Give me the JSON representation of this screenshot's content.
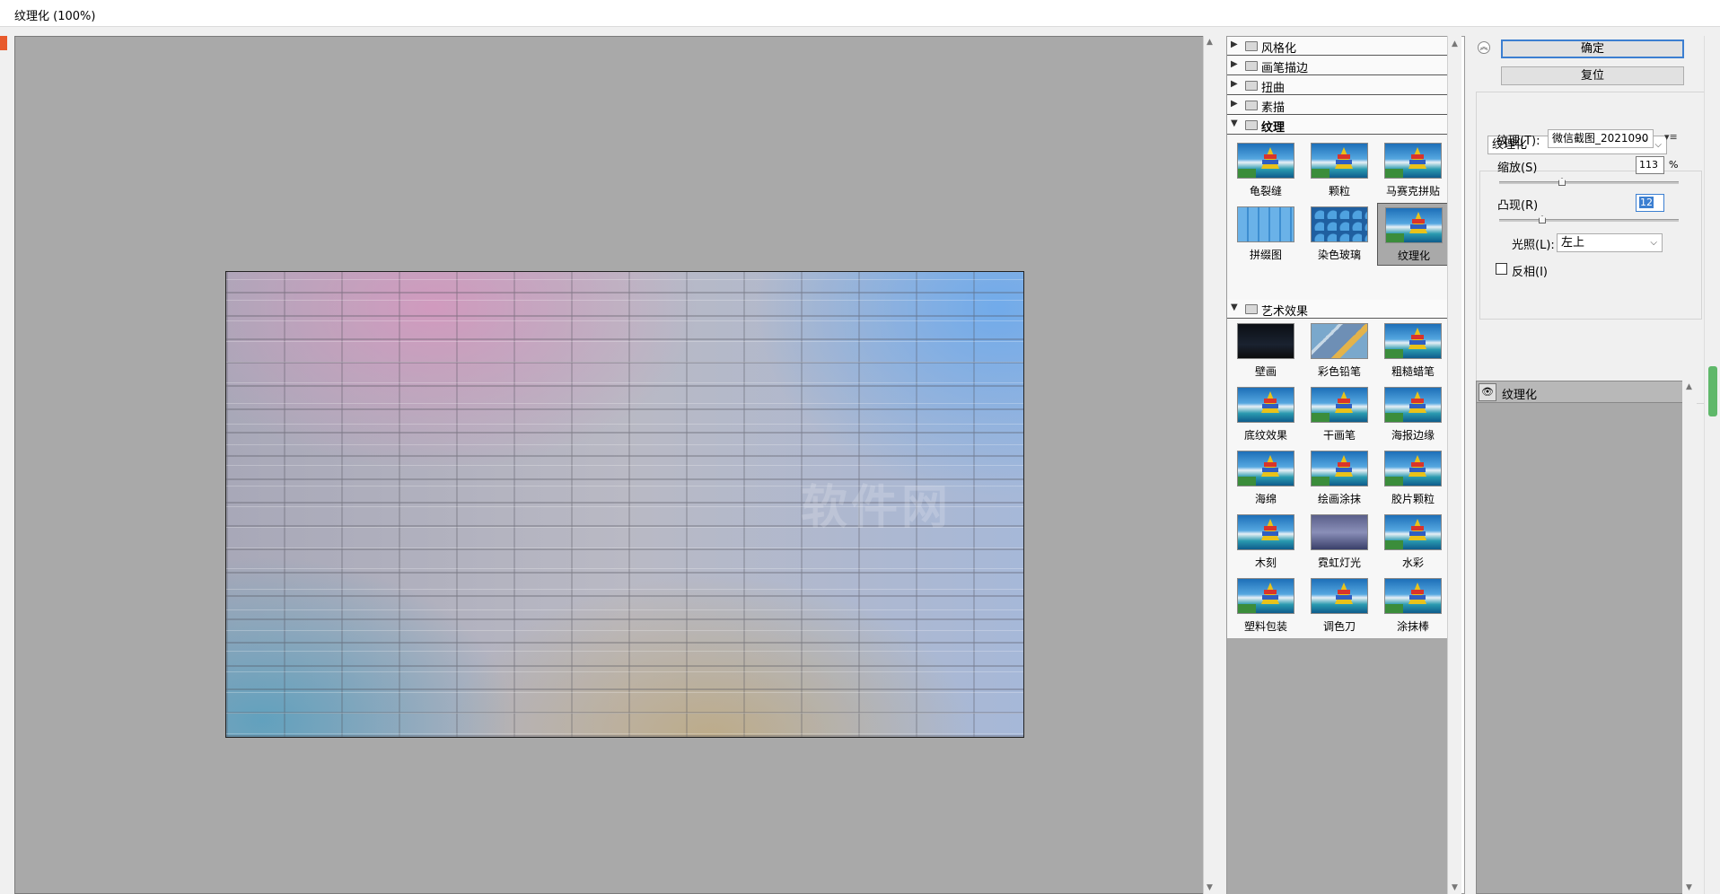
{
  "window": {
    "title": "纹理化 (100%)"
  },
  "preview": {
    "watermark": "软件网"
  },
  "filter_gallery": {
    "categories_collapsed": [
      "风格化",
      "画笔描边",
      "扭曲",
      "素描"
    ],
    "texture_category": "纹理",
    "texture_filters": [
      "龟裂缝",
      "颗粒",
      "马赛克拼贴",
      "拼缀图",
      "染色玻璃",
      "纹理化"
    ],
    "selected_filter": "纹理化",
    "art_category": "艺术效果",
    "art_filters": [
      "壁画",
      "彩色铅笔",
      "粗糙蜡笔",
      "底纹效果",
      "干画笔",
      "海报边缘",
      "海绵",
      "绘画涂抹",
      "胶片颗粒",
      "木刻",
      "霓虹灯光",
      "水彩",
      "塑料包装",
      "调色刀",
      "涂抹棒"
    ]
  },
  "buttons": {
    "ok": "确定",
    "reset": "复位"
  },
  "settings": {
    "filter_select": "纹理化",
    "texture_label": "纹理(T):",
    "texture_value": "微信截图_2021090",
    "scale_label": "缩放(S)",
    "scale_value": "113",
    "scale_unit": "%",
    "scale_fraction": 0.35,
    "relief_label": "凸现(R)",
    "relief_value": "12",
    "relief_fraction": 0.24,
    "light_label": "光照(L):",
    "light_value": "左上",
    "invert_label": "反相(I)",
    "invert_checked": false
  },
  "layers": {
    "items": [
      "纹理化"
    ]
  },
  "icons": {
    "collapse": "double-chevron-up-icon",
    "eye": "eye-icon",
    "folder": "folder-icon",
    "menu": "panel-menu-icon"
  }
}
